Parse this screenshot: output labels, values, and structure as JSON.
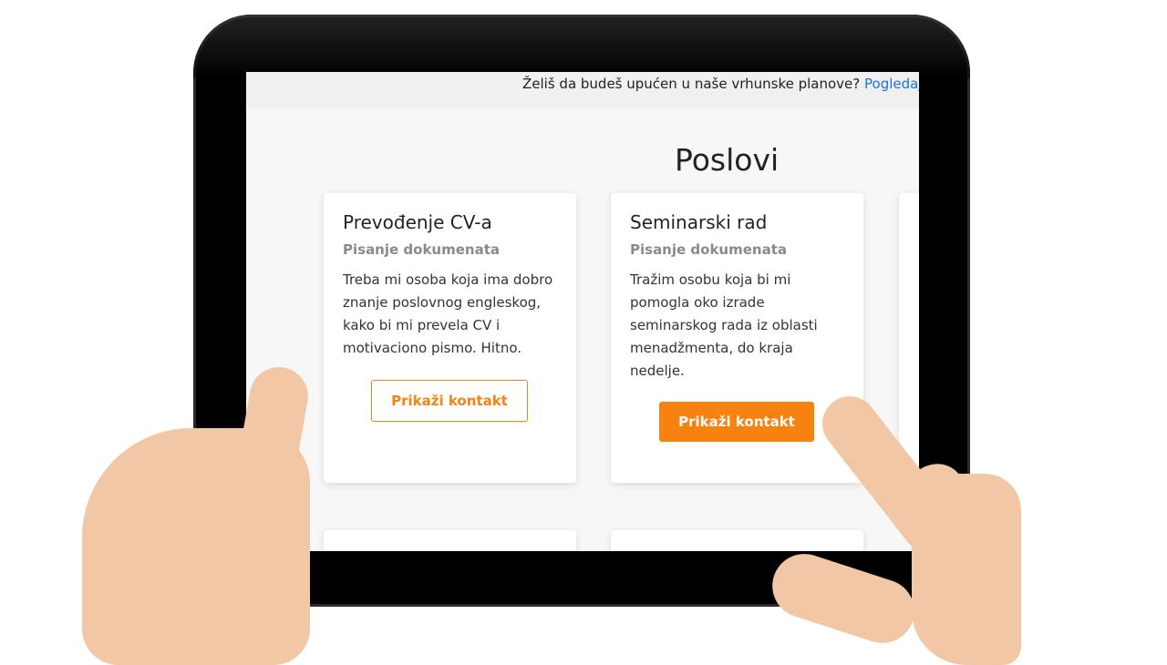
{
  "banner": {
    "text": "Želiš da budeš upućen u naše vrhunske planove?",
    "link": "Pogledaj"
  },
  "page_title": "Poslovi",
  "cards": [
    {
      "title": "Prevođenje CV-a",
      "category": "Pisanje dokumenata",
      "description": "Treba mi osoba koja ima dobro znanje poslovnog engleskog, kako bi mi prevela CV i motivaciono pismo. Hitno.",
      "button": "Prikaži kontakt"
    },
    {
      "title": "Seminarski rad",
      "category": "Pisanje dokumenata",
      "description": "Tražim osobu koja bi mi pomogla oko izrade seminarskog rada iz oblasti menadžmenta, do kraja nedelje.",
      "button": "Prikaži kontakt"
    }
  ],
  "colors": {
    "accent": "#f7820f",
    "link": "#1a73e8"
  }
}
